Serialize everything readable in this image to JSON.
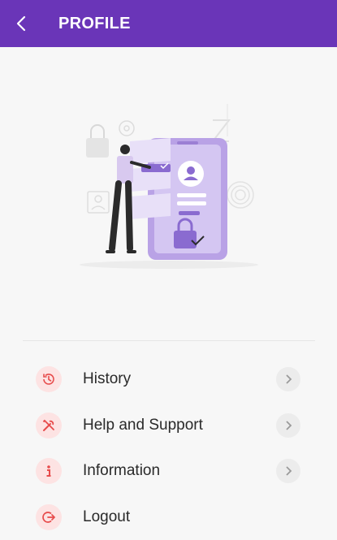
{
  "header": {
    "title": "PROFILE",
    "back_icon": "chevron-left-icon",
    "background": "#6a35b8"
  },
  "illustration": {
    "description_icon": "secure-login-illustration",
    "accent": "#9b7fd4"
  },
  "menu": {
    "items": [
      {
        "label": "History",
        "icon": "history-icon"
      },
      {
        "label": "Help and Support",
        "icon": "tools-icon"
      },
      {
        "label": "Information",
        "icon": "info-icon"
      },
      {
        "label": "Logout",
        "icon": "logout-icon"
      }
    ],
    "icon_color": "#e74c4c",
    "icon_bg": "#fde3e3"
  }
}
